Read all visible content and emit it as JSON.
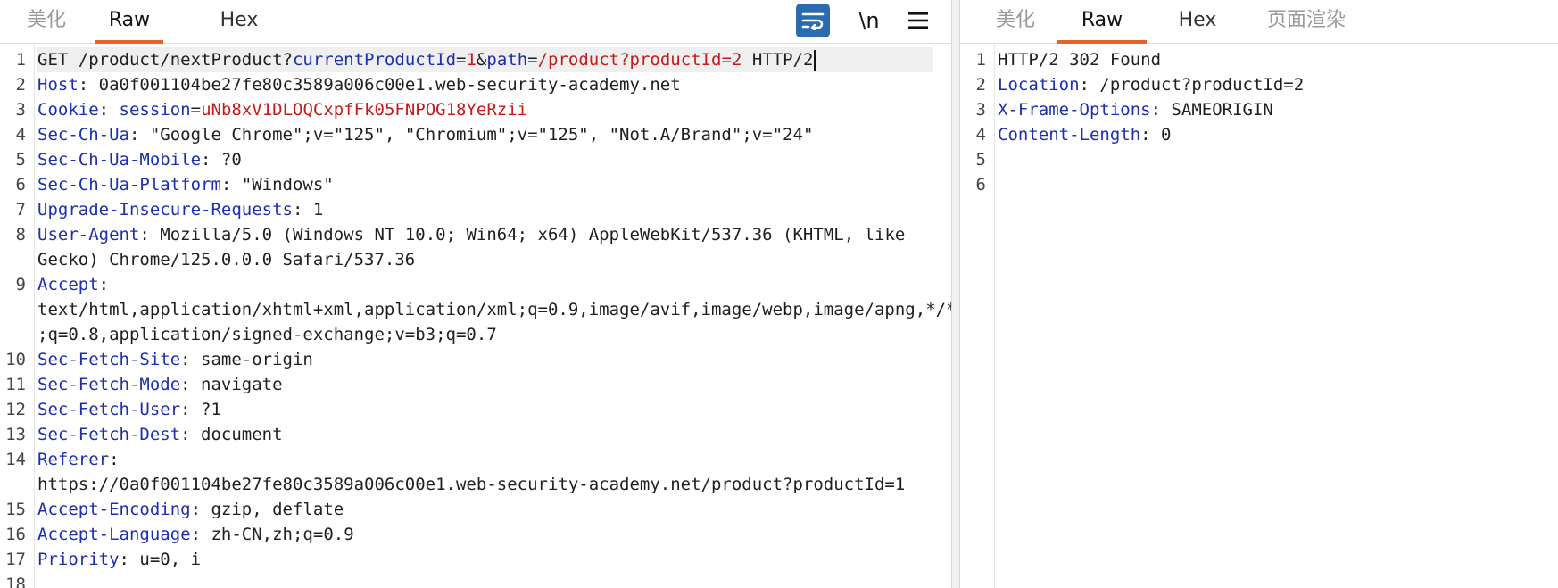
{
  "request_panel": {
    "tabs": [
      {
        "label": "美化"
      },
      {
        "label": "Raw"
      },
      {
        "label": "Hex"
      }
    ],
    "active_tab": "Raw",
    "toolbar": {
      "wrap_icon": "word-wrap-icon",
      "newline_label": "\\n",
      "menu_icon": "hamburger-menu-icon"
    },
    "line_numbers": [
      "1",
      "2",
      "3",
      "4",
      "5",
      "6",
      "7",
      "8",
      "9",
      "10",
      "11",
      "12",
      "13",
      "14",
      "15",
      "16",
      "17",
      "18"
    ],
    "lines": {
      "l1": {
        "method": "GET /product/nextProduct?",
        "p1_name": "currentProductId",
        "eq1": "=",
        "p1_val": "1",
        "amp": "&",
        "p2_name": "path",
        "eq2": "=",
        "p2_val": "/product?productId=2",
        "proto": " HTTP/2"
      },
      "l2": {
        "name": "Host",
        "sep": ": ",
        "value": "0a0f001104be27fe80c3589a006c00e1.web-security-academy.net"
      },
      "l3": {
        "name": "Cookie",
        "sep": ": ",
        "cname": "session",
        "ceq": "=",
        "cval": "uNb8xV1DLOQCxpfFk05FNPOG18YeRzii"
      },
      "l4": {
        "name": "Sec-Ch-Ua",
        "sep": ": ",
        "value": "\"Google Chrome\";v=\"125\", \"Chromium\";v=\"125\", \"Not.A/Brand\";v=\"24\""
      },
      "l5": {
        "name": "Sec-Ch-Ua-Mobile",
        "sep": ": ",
        "value": "?0"
      },
      "l6": {
        "name": "Sec-Ch-Ua-Platform",
        "sep": ": ",
        "value": "\"Windows\""
      },
      "l7": {
        "name": "Upgrade-Insecure-Requests",
        "sep": ": ",
        "value": "1"
      },
      "l8": {
        "name": "User-Agent",
        "sep": ": ",
        "value": "Mozilla/5.0 (Windows NT 10.0; Win64; x64) AppleWebKit/537.36 (KHTML, like",
        "cont": "Gecko) Chrome/125.0.0.0 Safari/537.36"
      },
      "l9": {
        "name": "Accept",
        "sep": ":",
        "cont1": "text/html,application/xhtml+xml,application/xml;q=0.9,image/avif,image/webp,image/apng,*/*",
        "cont2": ";q=0.8,application/signed-exchange;v=b3;q=0.7"
      },
      "l10": {
        "name": "Sec-Fetch-Site",
        "sep": ": ",
        "value": "same-origin"
      },
      "l11": {
        "name": "Sec-Fetch-Mode",
        "sep": ": ",
        "value": "navigate"
      },
      "l12": {
        "name": "Sec-Fetch-User",
        "sep": ": ",
        "value": "?1"
      },
      "l13": {
        "name": "Sec-Fetch-Dest",
        "sep": ": ",
        "value": "document"
      },
      "l14": {
        "name": "Referer",
        "sep": ":",
        "cont": "https://0a0f001104be27fe80c3589a006c00e1.web-security-academy.net/product?productId=1"
      },
      "l15": {
        "name": "Accept-Encoding",
        "sep": ": ",
        "value": "gzip, deflate"
      },
      "l16": {
        "name": "Accept-Language",
        "sep": ": ",
        "value": "zh-CN,zh;q=0.9"
      },
      "l17": {
        "name": "Priority",
        "sep": ": ",
        "value": "u=0, i"
      }
    }
  },
  "response_panel": {
    "tabs": [
      {
        "label": "美化"
      },
      {
        "label": "Raw"
      },
      {
        "label": "Hex"
      },
      {
        "label": "页面渲染"
      }
    ],
    "active_tab": "Raw",
    "line_numbers": [
      "1",
      "2",
      "3",
      "4",
      "5",
      "6"
    ],
    "lines": {
      "l1": {
        "value": "HTTP/2 302 Found"
      },
      "l2": {
        "name": "Location",
        "sep": ": ",
        "value": "/product?productId=2"
      },
      "l3": {
        "name": "X-Frame-Options",
        "sep": ": ",
        "value": "SAMEORIGIN"
      },
      "l4": {
        "name": "Content-Length",
        "sep": ": ",
        "value": "0"
      }
    }
  },
  "colors": {
    "accent_tab_underline": "#e8632b",
    "header_name": "#1c2fb0",
    "param_value": "#c51a1a",
    "wrap_button": "#2b6cb0"
  }
}
